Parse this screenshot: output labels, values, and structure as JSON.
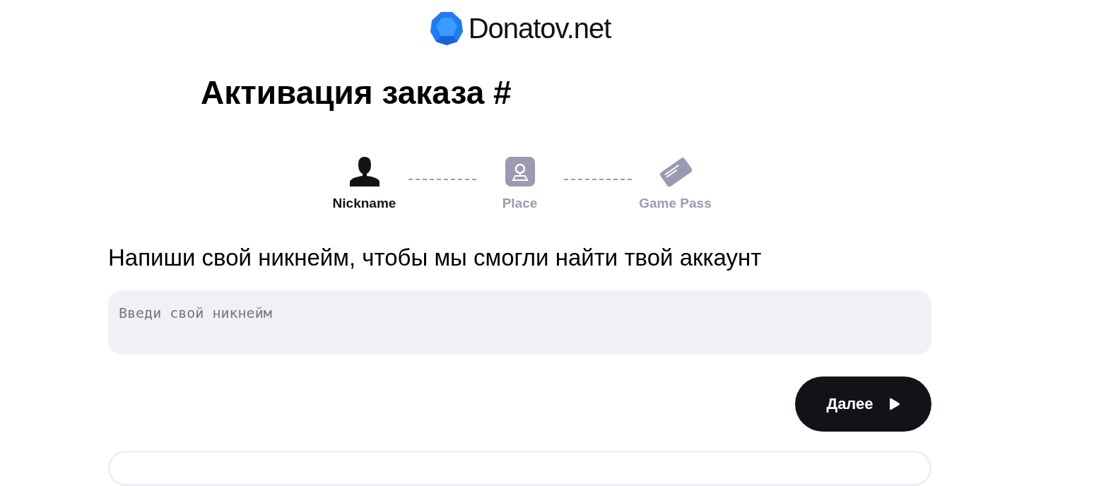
{
  "logo": {
    "text": "Donatov.net"
  },
  "title": "Активация заказа #",
  "steps": [
    {
      "kind": "person",
      "label": "Nickname",
      "selected": true
    },
    {
      "kind": "place",
      "label": "Place",
      "selected": false
    },
    {
      "kind": "card",
      "label": "Game Pass",
      "selected": false
    }
  ],
  "prompt": "Напиши свой никнейм, чтобы мы смогли найти твой аккаунт",
  "nickname_field": {
    "placeholder": "Введи свой никнейм"
  },
  "next_button": {
    "label": "Далее"
  }
}
